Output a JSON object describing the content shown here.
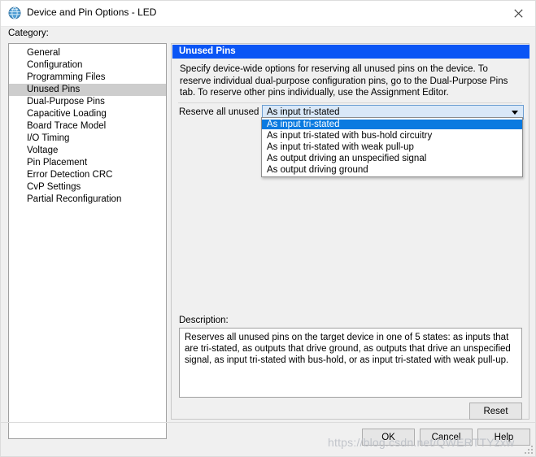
{
  "window": {
    "title": "Device and Pin Options - LED",
    "icon": "quartus-globe-icon",
    "close_label": "×"
  },
  "category": {
    "label": "Category:",
    "items": [
      {
        "label": "General",
        "selected": false
      },
      {
        "label": "Configuration",
        "selected": false
      },
      {
        "label": "Programming Files",
        "selected": false
      },
      {
        "label": "Unused Pins",
        "selected": true
      },
      {
        "label": "Dual-Purpose Pins",
        "selected": false
      },
      {
        "label": "Capacitive Loading",
        "selected": false
      },
      {
        "label": "Board Trace Model",
        "selected": false
      },
      {
        "label": "I/O Timing",
        "selected": false
      },
      {
        "label": "Voltage",
        "selected": false
      },
      {
        "label": "Pin Placement",
        "selected": false
      },
      {
        "label": "Error Detection CRC",
        "selected": false
      },
      {
        "label": "CvP Settings",
        "selected": false
      },
      {
        "label": "Partial Reconfiguration",
        "selected": false
      }
    ]
  },
  "panel": {
    "header": "Unused Pins",
    "description": "Specify device-wide options for reserving all unused pins on the device. To reserve individual dual-purpose configuration pins, go to the Dual-Purpose Pins tab. To reserve other pins individually, use the Assignment Editor.",
    "combo": {
      "label": "Reserve all unused pins:",
      "value": "As input tri-stated",
      "expanded": true,
      "options": [
        {
          "label": "As input tri-stated",
          "highlighted": true
        },
        {
          "label": "As input tri-stated with bus-hold circuitry",
          "highlighted": false
        },
        {
          "label": "As input tri-stated with weak pull-up",
          "highlighted": false
        },
        {
          "label": "As output driving an unspecified signal",
          "highlighted": false
        },
        {
          "label": "As output driving ground",
          "highlighted": false
        }
      ]
    },
    "description_group": {
      "label": "Description:",
      "text": "Reserves all unused pins on the target device in one of 5 states: as inputs that are tri-stated, as outputs that drive ground, as outputs that drive an unspecified signal, as input tri-stated with bus-hold, or as input tri-stated with weak pull-up."
    },
    "reset_label": "Reset"
  },
  "footer": {
    "ok_label": "OK",
    "cancel_label": "Cancel",
    "help_label": "Help"
  },
  "watermark": "https://blog.csdn.net/QWERTTYzxw",
  "colors": {
    "panel_header_blue": "#0a55f5",
    "dropdown_highlight_blue": "#0a7ae0",
    "sidebar_selection_gray": "#cdcdcd",
    "combo_fill": "#d9e8f8",
    "dialog_background": "#f0f0f0"
  }
}
